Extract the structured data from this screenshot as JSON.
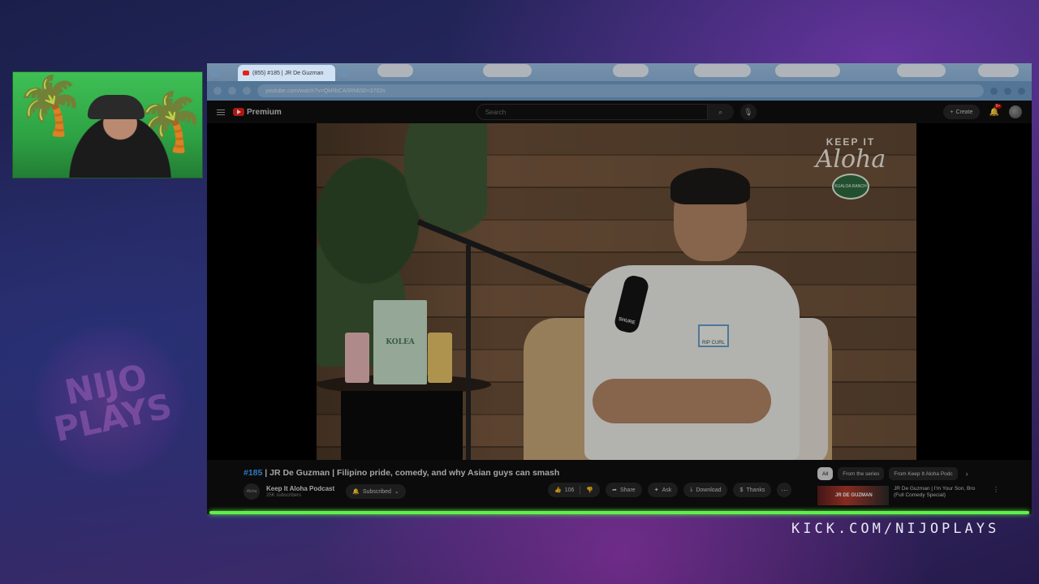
{
  "browser": {
    "tab_title": "(855) #185 | JR De Guzman",
    "url": "youtube.com/watch?v=QkRbCA0Rh6S0=3702s"
  },
  "youtube": {
    "logo_text": "Premium",
    "search_placeholder": "Search",
    "create_label": "Create",
    "notification_count": "9+"
  },
  "video": {
    "watermark_line1": "KEEP IT",
    "watermark_line2": "Aloha",
    "watermark_seal": "KUALOA RANCH",
    "box_brand": "KOLEA",
    "mic_label": "SHURE",
    "shirt_text": "RIP CURL",
    "title_episode": "#185",
    "title_rest": " | JR De Guzman | Filipino pride, comedy, and why Asian guys can smash"
  },
  "channel": {
    "avatar_text": "Aloha",
    "name": "Keep It Aloha Podcast",
    "subscribers": "25K subscribers",
    "subscribed_label": "Subscribed"
  },
  "actions": {
    "like_count": "106",
    "share_label": "Share",
    "ask_label": "Ask",
    "download_label": "Download",
    "thanks_label": "Thanks"
  },
  "sidebar": {
    "chips": [
      "All",
      "From the series",
      "From Keep It Aloha Podc"
    ],
    "rec_thumb_text": "JR DE GUZMAN",
    "rec_title": "JR De Guzman | I'm Your Son, Bro (Full Comedy Special)"
  },
  "overlay": {
    "logo_text": "NIJO PLAYS",
    "kick_url": "KICK.COM/NIJOPLAYS",
    "accent_color": "#5ff04a"
  }
}
